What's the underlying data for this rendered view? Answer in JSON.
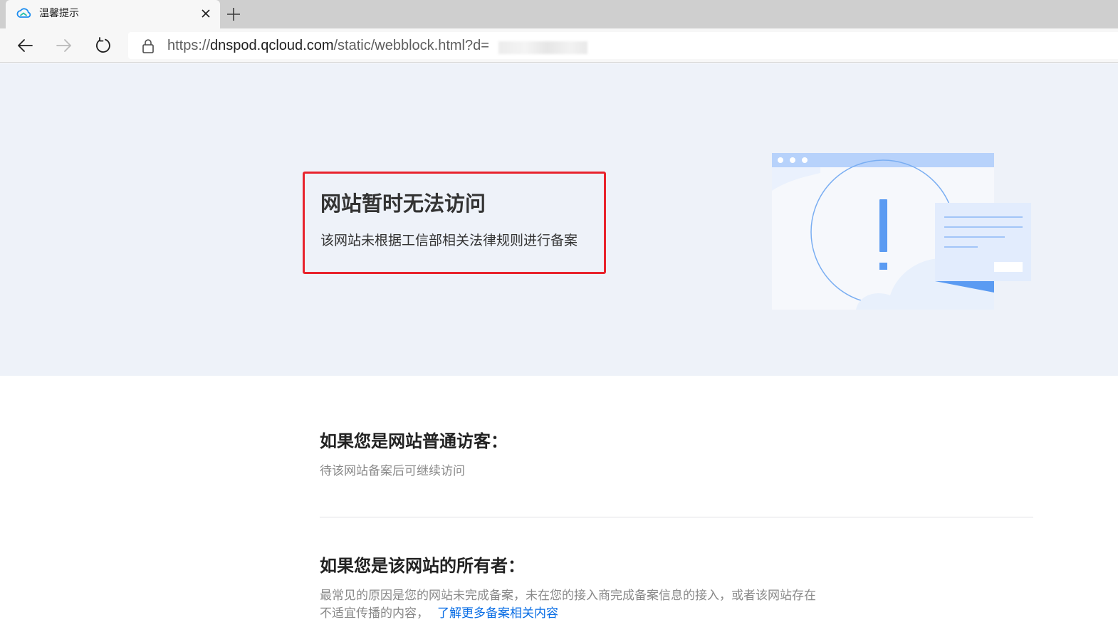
{
  "browser": {
    "tab": {
      "title": "温馨提示",
      "favicon": "cloud-icon"
    },
    "toolbar": {
      "url_scheme": "https://",
      "url_host": "dnspod.qcloud.com",
      "url_path": "/static/webblock.html?d="
    }
  },
  "hero": {
    "title": "网站暂时无法访问",
    "description": "该网站未根据工信部相关法律规则进行备案"
  },
  "visitor_section": {
    "title": "如果您是网站普通访客：",
    "text": "待该网站备案后可继续访问"
  },
  "owner_section": {
    "title": "如果您是该网站的所有者：",
    "text_line_1": "最常见的原因是您的网站未完成备案，未在您的接入商完成备案信息的接入，或者该网站存在",
    "text_line_2": "不适宜传播的内容，",
    "link_label": "了解更多备案相关内容"
  },
  "colors": {
    "hero_background": "#eef2f9",
    "highlight_border": "#e8232d",
    "link": "#0a6ee5",
    "illustration_accent": "#6fa8f5"
  }
}
